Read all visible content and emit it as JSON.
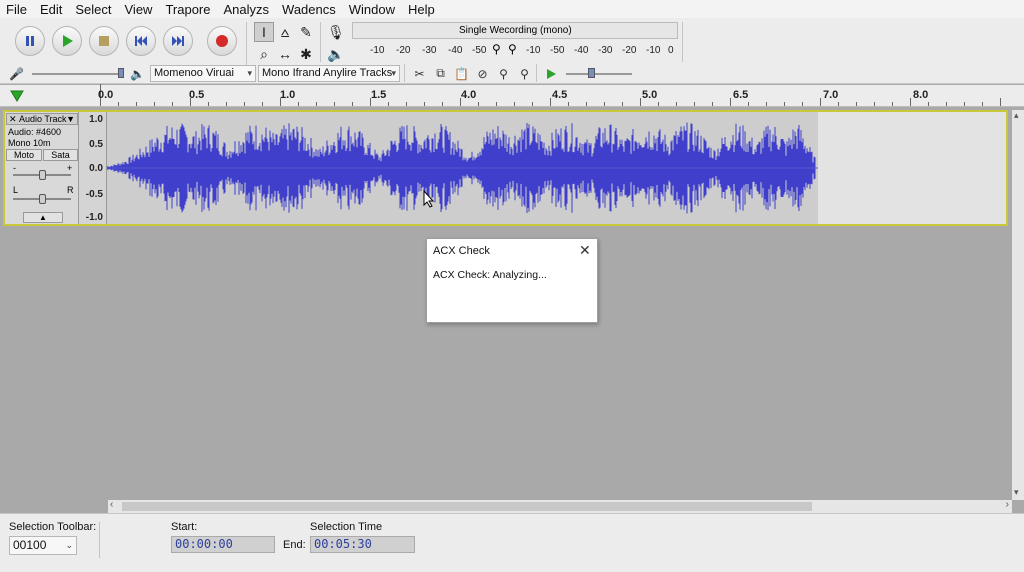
{
  "menu": [
    "File",
    "Edit",
    "Select",
    "View",
    "Trapore",
    "Analyzs",
    "Wadencs",
    "Window",
    "Help"
  ],
  "meter": {
    "title": "Single Wecording (mono)",
    "ticks_left": [
      "-10",
      "-20",
      "-30",
      "-40",
      "-50"
    ],
    "ticks_right": [
      "-10",
      "-50",
      "-40",
      "-30",
      "-20",
      "-10",
      "0"
    ],
    "end_value": "0"
  },
  "device": {
    "host": "Momenoo Viruai",
    "channels": "Mono Ifrand Anylire Tracks"
  },
  "ruler": {
    "labels": [
      "0.0",
      "0.5",
      "1.0",
      "1.5",
      "4.0",
      "4.5",
      "5.0",
      "6.5",
      "7.0",
      "8.0"
    ]
  },
  "track": {
    "name": "Audio Track",
    "info1": "Audio: #4600",
    "info2": "Mono 10m",
    "mute": "Moto",
    "solo": "Sata",
    "gain_minus": "-",
    "gain_plus": "+",
    "pan_left": "L",
    "pan_right": "R",
    "scale": [
      "1.0",
      "0.5",
      "0.0",
      "-0.5",
      "-1.0"
    ]
  },
  "dialog": {
    "title": "ACX Check",
    "message": "ACX Check: Analyzing..."
  },
  "selection": {
    "toolbar_label": "Selection Toolbar:",
    "rate": "00100",
    "start_label": "Start:",
    "start": "00:00:00",
    "time_label": "Selection Time",
    "end_label": "End:",
    "end": "00:05:30"
  },
  "colors": {
    "waveform": "#3f3fcc",
    "track_border": "#c9c83a",
    "play": "#2aa52a",
    "record": "#d42a2a"
  }
}
